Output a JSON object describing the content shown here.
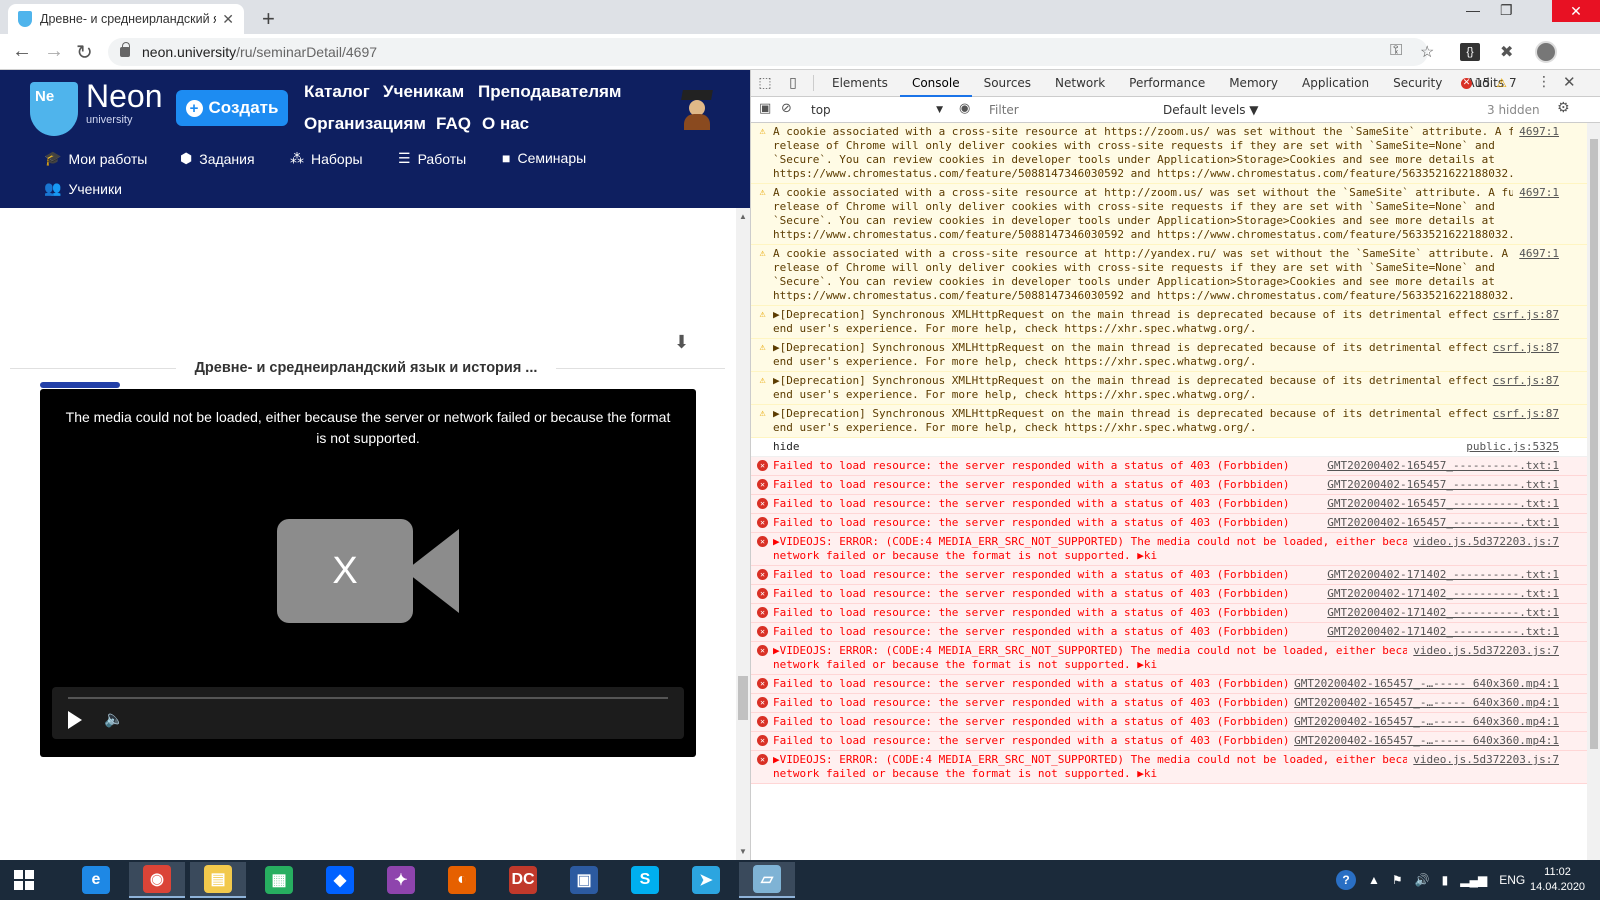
{
  "browser": {
    "tab_title": "Древне- и среднеирландский я",
    "tab_close": "✕",
    "new_tab": "+",
    "url_host": "neon.university",
    "url_path": "/ru/seminarDetail/4697",
    "win_min": "—",
    "win_max": "❐",
    "win_close": "✕"
  },
  "site": {
    "logo_letters": "Ne",
    "logo_name": "Neon",
    "logo_sub": "university",
    "create_label": "Создать",
    "nav": [
      "Каталог",
      "Ученикам",
      "Преподавателям",
      "Организациям",
      "FAQ",
      "О нас"
    ],
    "subnav": [
      {
        "icon": "graduation-cap-icon",
        "label": "Мои работы"
      },
      {
        "icon": "cube-icon",
        "label": "Задания"
      },
      {
        "icon": "cubes-icon",
        "label": "Наборы"
      },
      {
        "icon": "list-icon",
        "label": "Работы"
      },
      {
        "icon": "video-icon",
        "label": "Семинары"
      },
      {
        "icon": "users-icon",
        "label": "Ученики"
      }
    ],
    "seminar_title": "Древне- и среднеирландский язык и история ...",
    "player_error": "The media could not be loaded, either because the server or network failed or because the format is not supported.",
    "player_x": "X"
  },
  "devtools": {
    "tabs": [
      "Elements",
      "Console",
      "Sources",
      "Network",
      "Performance",
      "Memory",
      "Application",
      "Security",
      "Audits"
    ],
    "active_tab": "Console",
    "error_count": "15",
    "warning_count": "7",
    "context": "top",
    "filter_placeholder": "Filter",
    "levels": "Default levels ▼",
    "hidden": "3 hidden",
    "messages": [
      {
        "level": "warn",
        "src": "4697:1",
        "text": "A cookie associated with a cross-site resource at https://zoom.us/ was set without the `SameSite` attribute. A future release of Chrome will only deliver cookies with cross-site requests if they are set with `SameSite=None` and `Secure`. You can review cookies in developer tools under Application>Storage>Cookies and see more details at https://www.chromestatus.com/feature/5088147346030592 and https://www.chromestatus.com/feature/5633521622188032."
      },
      {
        "level": "warn",
        "src": "4697:1",
        "text": "A cookie associated with a cross-site resource at http://zoom.us/ was set without the `SameSite` attribute. A future release of Chrome will only deliver cookies with cross-site requests if they are set with `SameSite=None` and `Secure`. You can review cookies in developer tools under Application>Storage>Cookies and see more details at https://www.chromestatus.com/feature/5088147346030592 and https://www.chromestatus.com/feature/5633521622188032."
      },
      {
        "level": "warn",
        "src": "4697:1",
        "text": "A cookie associated with a cross-site resource at http://yandex.ru/ was set without the `SameSite` attribute. A future release of Chrome will only deliver cookies with cross-site requests if they are set with `SameSite=None` and `Secure`. You can review cookies in developer tools under Application>Storage>Cookies and see more details at https://www.chromestatus.com/feature/5088147346030592 and https://www.chromestatus.com/feature/5633521622188032."
      },
      {
        "level": "warn",
        "src": "csrf.js:87",
        "text": "▶[Deprecation] Synchronous XMLHttpRequest on the main thread is deprecated because of its detrimental effects to the end user's experience. For more help, check https://xhr.spec.whatwg.org/."
      },
      {
        "level": "warn",
        "src": "csrf.js:87",
        "text": "▶[Deprecation] Synchronous XMLHttpRequest on the main thread is deprecated because of its detrimental effects to the end user's experience. For more help, check https://xhr.spec.whatwg.org/."
      },
      {
        "level": "warn",
        "src": "csrf.js:87",
        "text": "▶[Deprecation] Synchronous XMLHttpRequest on the main thread is deprecated because of its detrimental effects to the end user's experience. For more help, check https://xhr.spec.whatwg.org/."
      },
      {
        "level": "warn",
        "src": "csrf.js:87",
        "text": "▶[Deprecation] Synchronous XMLHttpRequest on the main thread is deprecated because of its detrimental effects to the end user's experience. For more help, check https://xhr.spec.whatwg.org/."
      },
      {
        "level": "log",
        "src": "public.js:5325",
        "text": "hide"
      },
      {
        "level": "error",
        "src": "GMT20200402-165457_----------.txt:1",
        "text": "Failed to load resource: the server responded with a status of 403 (Forbbiden)"
      },
      {
        "level": "error",
        "src": "GMT20200402-165457_----------.txt:1",
        "text": "Failed to load resource: the server responded with a status of 403 (Forbbiden)"
      },
      {
        "level": "error",
        "src": "GMT20200402-165457_----------.txt:1",
        "text": "Failed to load resource: the server responded with a status of 403 (Forbbiden)"
      },
      {
        "level": "error",
        "src": "GMT20200402-165457_----------.txt:1",
        "text": "Failed to load resource: the server responded with a status of 403 (Forbbiden)"
      },
      {
        "level": "error",
        "src": "video.js.5d372203.js:7",
        "text": "▶VIDEOJS: ERROR: (CODE:4 MEDIA_ERR_SRC_NOT_SUPPORTED) The media could not be loaded, either because the server or network failed or because the format is not supported. ▶ki"
      },
      {
        "level": "error",
        "src": "GMT20200402-171402_----------.txt:1",
        "text": "Failed to load resource: the server responded with a status of 403 (Forbbiden)"
      },
      {
        "level": "error",
        "src": "GMT20200402-171402_----------.txt:1",
        "text": "Failed to load resource: the server responded with a status of 403 (Forbbiden)"
      },
      {
        "level": "error",
        "src": "GMT20200402-171402_----------.txt:1",
        "text": "Failed to load resource: the server responded with a status of 403 (Forbbiden)"
      },
      {
        "level": "error",
        "src": "GMT20200402-171402_----------.txt:1",
        "text": "Failed to load resource: the server responded with a status of 403 (Forbbiden)"
      },
      {
        "level": "error",
        "src": "video.js.5d372203.js:7",
        "text": "▶VIDEOJS: ERROR: (CODE:4 MEDIA_ERR_SRC_NOT_SUPPORTED) The media could not be loaded, either because the server or network failed or because the format is not supported. ▶ki"
      },
      {
        "level": "error",
        "src": "GMT20200402-165457_-…----- 640x360.mp4:1",
        "text": "Failed to load resource: the server responded with a status of 403 (Forbbiden)"
      },
      {
        "level": "error",
        "src": "GMT20200402-165457_-…----- 640x360.mp4:1",
        "text": "Failed to load resource: the server responded with a status of 403 (Forbbiden)"
      },
      {
        "level": "error",
        "src": "GMT20200402-165457_-…----- 640x360.mp4:1",
        "text": "Failed to load resource: the server responded with a status of 403 (Forbbiden)"
      },
      {
        "level": "error",
        "src": "GMT20200402-165457_-…----- 640x360.mp4:1",
        "text": "Failed to load resource: the server responded with a status of 403 (Forbbiden)"
      },
      {
        "level": "error",
        "src": "video.js.5d372203.js:7",
        "text": "▶VIDEOJS: ERROR: (CODE:4 MEDIA_ERR_SRC_NOT_SUPPORTED) The media could not be loaded, either because the server or network failed or because the format is not supported. ▶ki"
      }
    ]
  },
  "taskbar": {
    "apps": [
      "internet-explorer",
      "chrome",
      "file-explorer",
      "green-app",
      "dropbox",
      "color-app",
      "firefox",
      "dc-app",
      "network-app",
      "skype",
      "telegram",
      "notepad-app"
    ],
    "lang": "ENG",
    "time": "11:02",
    "date": "14.04.2020"
  }
}
